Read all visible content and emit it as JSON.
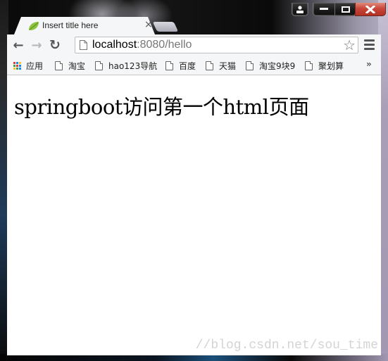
{
  "window": {
    "caption_buttons": {
      "user_icon": "user-icon",
      "minimize_icon": "minimize-icon",
      "maximize_icon": "maximize-icon",
      "close_icon": "close-icon",
      "close_color": "#c9463a"
    }
  },
  "tab": {
    "favicon": "spring-leaf-icon",
    "title": "Insert title here",
    "close_glyph": "×"
  },
  "toolbar": {
    "back_glyph": "←",
    "forward_glyph": "→",
    "reload_glyph": "↻",
    "url_host": "localhost",
    "url_rest": ":8080/hello",
    "star_glyph": "☆"
  },
  "bookmarks": {
    "apps_label": "应用",
    "items": [
      {
        "label": "淘宝"
      },
      {
        "label": "hao123导航"
      },
      {
        "label": "百度"
      },
      {
        "label": "天猫"
      },
      {
        "label": "淘宝9块9"
      },
      {
        "label": "聚划算"
      }
    ],
    "overflow_glyph": "»"
  },
  "page": {
    "heading": "springboot访问第一个html页面"
  },
  "watermark": "//blog.csdn.net/sou_time"
}
